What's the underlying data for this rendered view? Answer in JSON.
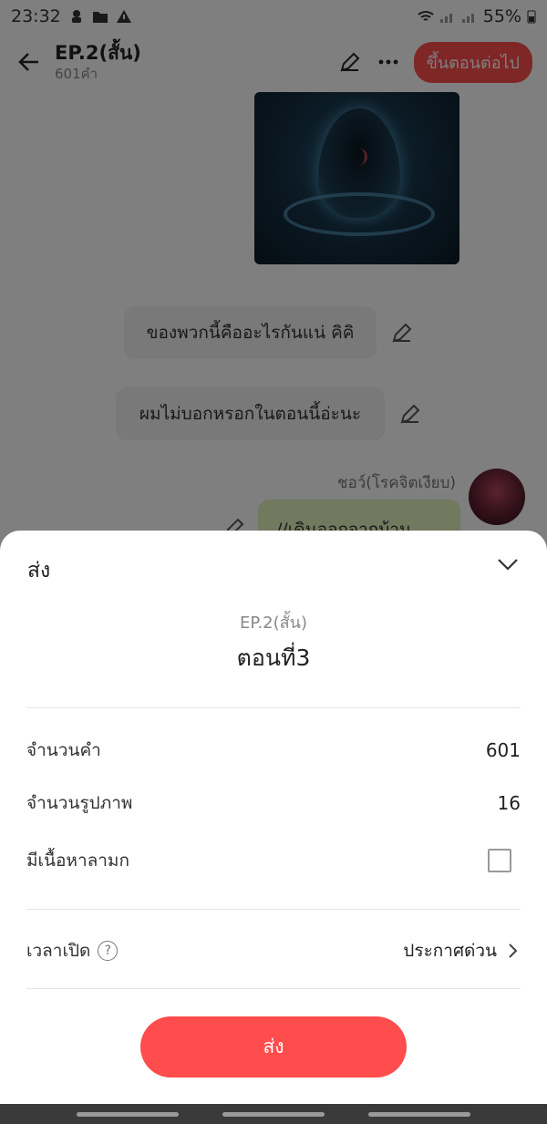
{
  "status": {
    "time": "23:32",
    "battery": "55%"
  },
  "header": {
    "title": "EP.2(สั้น)",
    "subtitle": "601คำ",
    "publish_label": "ขึ้นตอนต่อไป"
  },
  "chat": {
    "bubble1": "ของพวกนี้คืออะไรกันแน่ คิคิ",
    "bubble2": "ผมไม่บอกหรอกในตอนนี้อ่ะนะ",
    "speaker": "ชอว์(โรคจิตเงียบ)",
    "bubble3": "//เดินออกจากบ้าน"
  },
  "sheet": {
    "header": "ส่ง",
    "episode": "EP.2(สั้น)",
    "chapter": "ตอนที่3",
    "word_count_label": "จำนวนคำ",
    "word_count_value": "601",
    "image_count_label": "จำนวนรูปภาพ",
    "image_count_value": "16",
    "mature_label": "มีเนื้อหาลามก",
    "mature_checked": false,
    "open_time_label": "เวลาเปิด",
    "open_time_value": "ประกาศด่วน",
    "help_symbol": "?",
    "send_label": "ส่ง"
  },
  "colors": {
    "accent": "#ff4c4c",
    "green_bubble": "#e3f3bd"
  }
}
